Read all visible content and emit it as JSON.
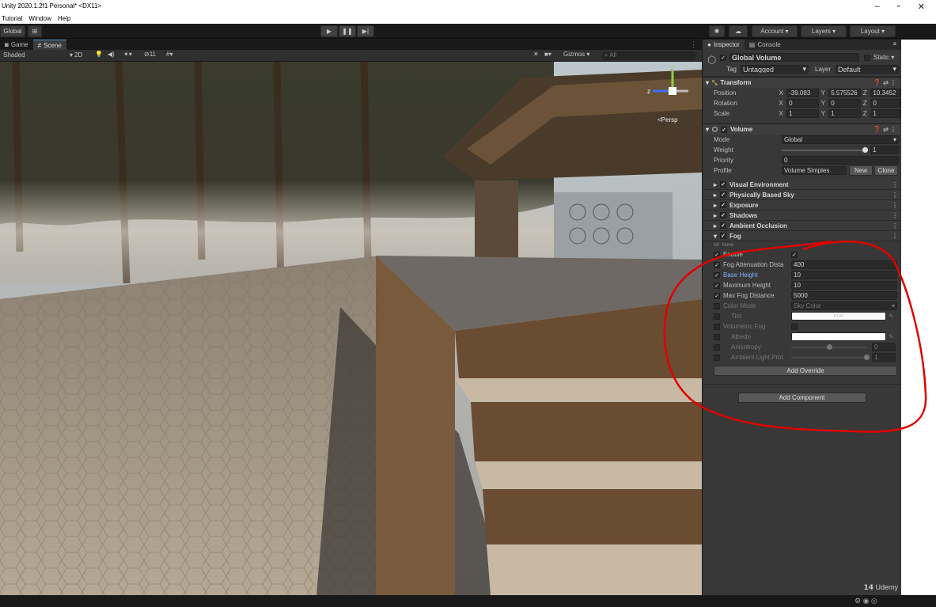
{
  "window": {
    "title": "Unity 2020.1.2f1 Personal* <DX11>",
    "minimize": "–",
    "maximize": "▫",
    "close": "✕"
  },
  "menu": [
    "Tutorial",
    "Window",
    "Help"
  ],
  "toolbar": {
    "global": "Global",
    "account": "Account ▾",
    "layers": "Layers ▾",
    "layout": "Layout ▾"
  },
  "scene": {
    "tabs": [
      {
        "label": "Game",
        "icon": "gamepad-icon"
      },
      {
        "label": "Scene",
        "icon": "grid-icon"
      }
    ],
    "shading": "Shaded",
    "mode2d": "2D",
    "hidden_count": "11",
    "gizmos": "Gizmos ▾",
    "search_placeholder": "All",
    "persp": "<Persp"
  },
  "inspector": {
    "tabs": [
      "Inspector",
      "Console"
    ],
    "object_name": "Global Volume",
    "static_label": "Static ▾",
    "tag_label": "Tag",
    "tag_value": "Untagged",
    "layer_label": "Layer",
    "layer_value": "Default",
    "transform": {
      "title": "Transform",
      "position": {
        "label": "Position",
        "x": "-39.083",
        "y": "5.575526",
        "z": "10.3452"
      },
      "rotation": {
        "label": "Rotation",
        "x": "0",
        "y": "0",
        "z": "0"
      },
      "scale": {
        "label": "Scale",
        "x": "1",
        "y": "1",
        "z": "1"
      }
    },
    "volume": {
      "title": "Volume",
      "mode_label": "Mode",
      "mode_value": "Global",
      "weight_label": "Weight",
      "weight_value": "1",
      "priority_label": "Priority",
      "priority_value": "0",
      "profile_label": "Profile",
      "profile_value": "Volume Simples",
      "new_btn": "New",
      "clone_btn": "Clone"
    },
    "overrides": [
      "Visual Environment",
      "Physically Based Sky",
      "Exposure",
      "Shadows",
      "Ambient Occlusion",
      "Fog"
    ],
    "fog": {
      "all": "All",
      "none": "None",
      "enable": "Enable",
      "attenuation_label": "Fog Attenuation Dista",
      "attenuation_value": "400",
      "base_height_label": "Base Height",
      "base_height_value": "10",
      "max_height_label": "Maximum Height",
      "max_height_value": "10",
      "max_distance_label": "Max Fog Distance",
      "max_distance_value": "5000",
      "color_mode_label": "Color Mode",
      "color_mode_value": "Sky Color",
      "tint_label": "Tint",
      "tint_value": "HDR",
      "volumetric_label": "Volumetric Fog",
      "albedo_label": "Albedo",
      "anisotropy_label": "Anisotropy",
      "anisotropy_value": "0",
      "ambient_probe_label": "Ambient Light Prot",
      "ambient_probe_value": "1"
    },
    "add_override": "Add Override",
    "add_component": "Add Component"
  },
  "watermark": "Udemy",
  "colors": {
    "accent": "#4a88cc",
    "annotation": "#e00000",
    "panel": "#383838"
  }
}
